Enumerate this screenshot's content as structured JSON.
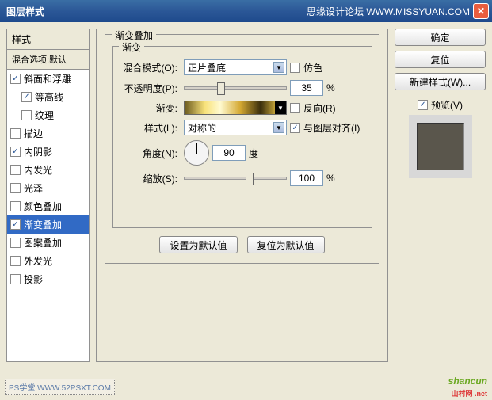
{
  "title": "图层样式",
  "titlebar_right": "思缘设计论坛  WWW.MISSYUAN.COM",
  "left": {
    "header": "样式",
    "sub": "混合选项:默认",
    "items": [
      {
        "label": "斜面和浮雕",
        "checked": true,
        "indent": false
      },
      {
        "label": "等高线",
        "checked": true,
        "indent": true
      },
      {
        "label": "纹理",
        "checked": false,
        "indent": true
      },
      {
        "label": "描边",
        "checked": false,
        "indent": false
      },
      {
        "label": "内阴影",
        "checked": true,
        "indent": false
      },
      {
        "label": "内发光",
        "checked": false,
        "indent": false
      },
      {
        "label": "光泽",
        "checked": false,
        "indent": false
      },
      {
        "label": "颜色叠加",
        "checked": false,
        "indent": false
      },
      {
        "label": "渐变叠加",
        "checked": true,
        "indent": false,
        "selected": true
      },
      {
        "label": "图案叠加",
        "checked": false,
        "indent": false
      },
      {
        "label": "外发光",
        "checked": false,
        "indent": false
      },
      {
        "label": "投影",
        "checked": false,
        "indent": false
      }
    ]
  },
  "center": {
    "group_outer": "渐变叠加",
    "group_inner": "渐变",
    "blend_label": "混合模式(O):",
    "blend_value": "正片叠底",
    "dither_label": "仿色",
    "opacity_label": "不透明度(P):",
    "opacity_value": "35",
    "opacity_unit": "%",
    "gradient_label": "渐变:",
    "reverse_label": "反向(R)",
    "style_label": "样式(L):",
    "style_value": "对称的",
    "align_label": "与图层对齐(I)",
    "angle_label": "角度(N):",
    "angle_value": "90",
    "angle_unit": "度",
    "scale_label": "缩放(S):",
    "scale_value": "100",
    "scale_unit": "%",
    "btn_default": "设置为默认值",
    "btn_reset": "复位为默认值"
  },
  "right": {
    "ok": "确定",
    "cancel": "复位",
    "new_style": "新建样式(W)...",
    "preview": "预览(V)"
  },
  "footer": {
    "left_mark": "PS学堂  WWW.52PSXT.COM",
    "right_mark": "shancun",
    "right_sub": "山村网 .net"
  }
}
